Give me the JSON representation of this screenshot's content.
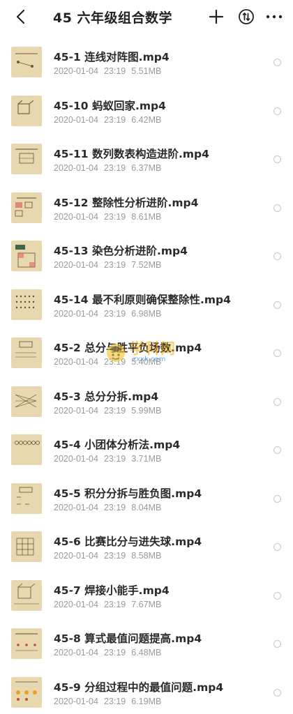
{
  "header": {
    "title": "45 六年级组合数学",
    "back_icon": "chevron-left-icon",
    "plus_icon": "plus-icon",
    "sort_icon": "sort-icon",
    "more_icon": "more-icon"
  },
  "files": [
    {
      "name": "45-1 连线对阵图.mp4",
      "date": "2020-01-04",
      "time": "23:19",
      "size": "5.51MB"
    },
    {
      "name": "45-10 蚂蚁回家.mp4",
      "date": "2020-01-04",
      "time": "23:19",
      "size": "6.42MB"
    },
    {
      "name": "45-11 数列数表构造进阶.mp4",
      "date": "2020-01-04",
      "time": "23:19",
      "size": "6.37MB"
    },
    {
      "name": "45-12 整除性分析进阶.mp4",
      "date": "2020-01-04",
      "time": "23:19",
      "size": "8.61MB"
    },
    {
      "name": "45-13 染色分析进阶.mp4",
      "date": "2020-01-04",
      "time": "23:19",
      "size": "7.52MB"
    },
    {
      "name": "45-14 最不利原则确保整除性.mp4",
      "date": "2020-01-04",
      "time": "23:19",
      "size": "6.98MB"
    },
    {
      "name": "45-2 总分与胜平负场数.mp4",
      "date": "2020-01-04",
      "time": "23:19",
      "size": "5.40MB"
    },
    {
      "name": "45-3 总分分拆.mp4",
      "date": "2020-01-04",
      "time": "23:19",
      "size": "5.99MB"
    },
    {
      "name": "45-4 小团体分析法.mp4",
      "date": "2020-01-04",
      "time": "23:19",
      "size": "3.71MB"
    },
    {
      "name": "45-5 积分分拆与胜负图.mp4",
      "date": "2020-01-04",
      "time": "23:19",
      "size": "8.04MB"
    },
    {
      "name": "45-6 比赛比分与进失球.mp4",
      "date": "2020-01-04",
      "time": "23:19",
      "size": "8.58MB"
    },
    {
      "name": "45-7 焊接小能手.mp4",
      "date": "2020-01-04",
      "time": "23:19",
      "size": "7.67MB"
    },
    {
      "name": "45-8 算式最值问题提高.mp4",
      "date": "2020-01-04",
      "time": "23:19",
      "size": "6.48MB"
    },
    {
      "name": "45-9 分组过程中的最值问题.mp4",
      "date": "2020-01-04",
      "time": "23:19",
      "size": "6.19MB"
    }
  ],
  "watermark": {
    "text": "学科网",
    "url": "zxxk.com"
  },
  "colors": {
    "title": "#222222",
    "meta": "#9a9a9a",
    "thumb_bg": "#e8d8b0",
    "watermark": "#f2a800"
  }
}
